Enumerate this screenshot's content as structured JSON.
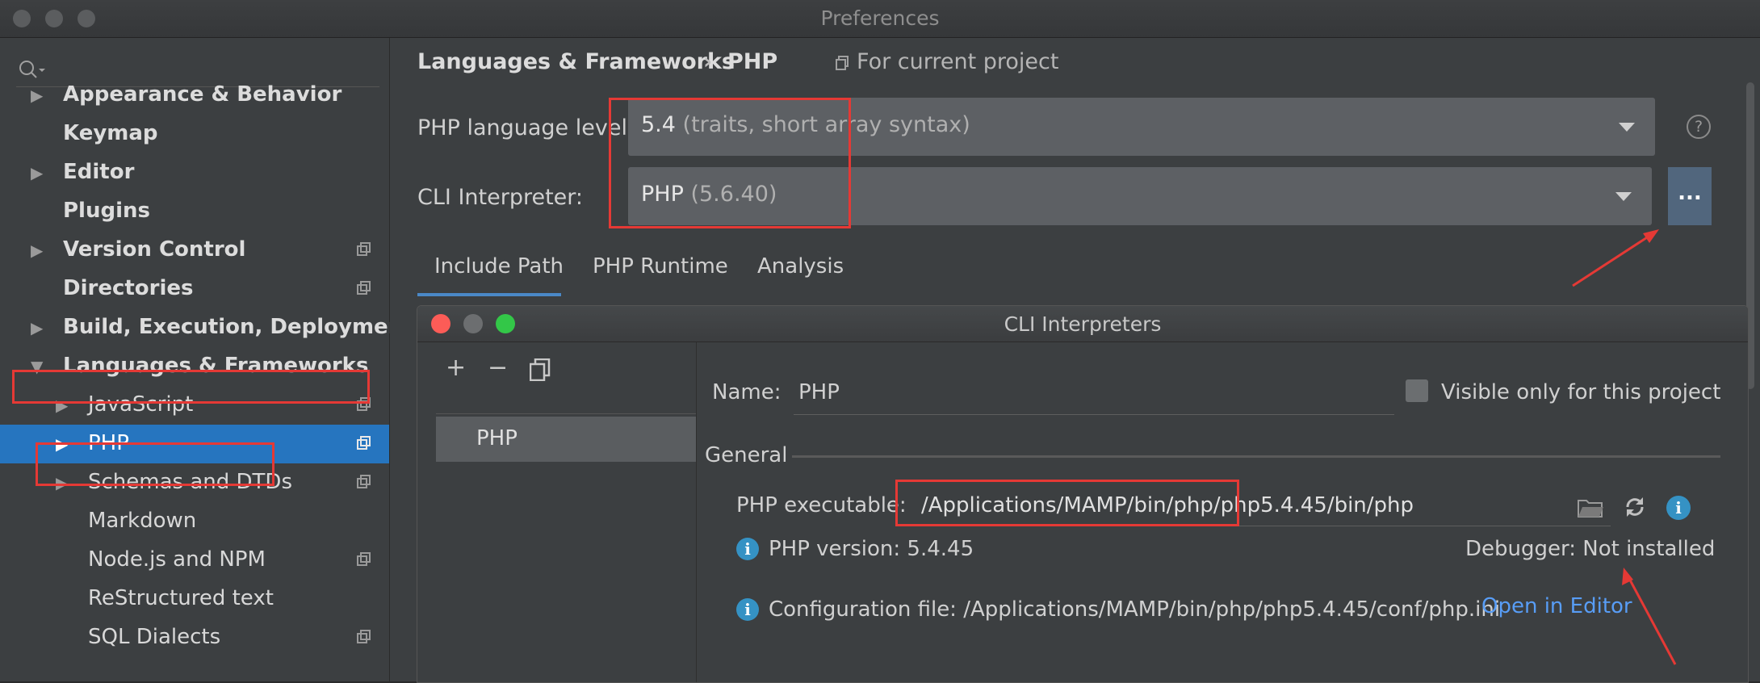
{
  "window": {
    "title": "Preferences"
  },
  "sidebar": {
    "items": [
      {
        "label": "Appearance & Behavior",
        "arrow": "▶",
        "bold": true
      },
      {
        "label": "Keymap",
        "arrow": "",
        "bold": true
      },
      {
        "label": "Editor",
        "arrow": "▶",
        "bold": true
      },
      {
        "label": "Plugins",
        "arrow": "",
        "bold": true
      },
      {
        "label": "Version Control",
        "arrow": "▶",
        "bold": true
      },
      {
        "label": "Directories",
        "arrow": "",
        "bold": true
      },
      {
        "label": "Build, Execution, Deployment",
        "arrow": "▶",
        "bold": true
      },
      {
        "label": "Languages & Frameworks",
        "arrow": "▼",
        "bold": true
      },
      {
        "label": "JavaScript",
        "arrow": "▶",
        "bold": false
      },
      {
        "label": "PHP",
        "arrow": "▶",
        "bold": false
      },
      {
        "label": "Schemas and DTDs",
        "arrow": "▶",
        "bold": false
      },
      {
        "label": "Markdown",
        "arrow": "",
        "bold": false
      },
      {
        "label": "Node.js and NPM",
        "arrow": "",
        "bold": false
      },
      {
        "label": "ReStructured text",
        "arrow": "",
        "bold": false
      },
      {
        "label": "SQL Dialects",
        "arrow": "",
        "bold": false
      }
    ]
  },
  "main": {
    "breadcrumb": {
      "parent": "Languages & Frameworks",
      "separator": "›",
      "current": "PHP",
      "scope": "For current project"
    },
    "language_level": {
      "label": "PHP language level:",
      "value": "5.4",
      "detail": "(traits, short array syntax)"
    },
    "cli_interpreter": {
      "label": "CLI Interpreter:",
      "value": "PHP",
      "detail": "(5.6.40)",
      "browse_button": "..."
    },
    "help_icon": "?",
    "tabs": [
      "Include Path",
      "PHP Runtime",
      "Analysis"
    ]
  },
  "dialog": {
    "title": "CLI Interpreters",
    "toolbar": {
      "add": "+",
      "remove": "−"
    },
    "interpreters": [
      "PHP"
    ],
    "name_label": "Name:",
    "name_value": "PHP",
    "visible_only_label": "Visible only for this project",
    "general_label": "General",
    "executable_label": "PHP executable:",
    "executable_value": "/Applications/MAMP/bin/php/php5.4.45/bin/php",
    "php_version": "PHP version: 5.4.45",
    "debugger": "Debugger: Not installed",
    "config_file": "Configuration file: /Applications/MAMP/bin/php/php5.4.45/conf/php.ini",
    "open_in_editor": "Open in Editor"
  },
  "colors": {
    "accent": "#2675bf",
    "highlight_box": "#e53935",
    "link": "#589df6"
  }
}
